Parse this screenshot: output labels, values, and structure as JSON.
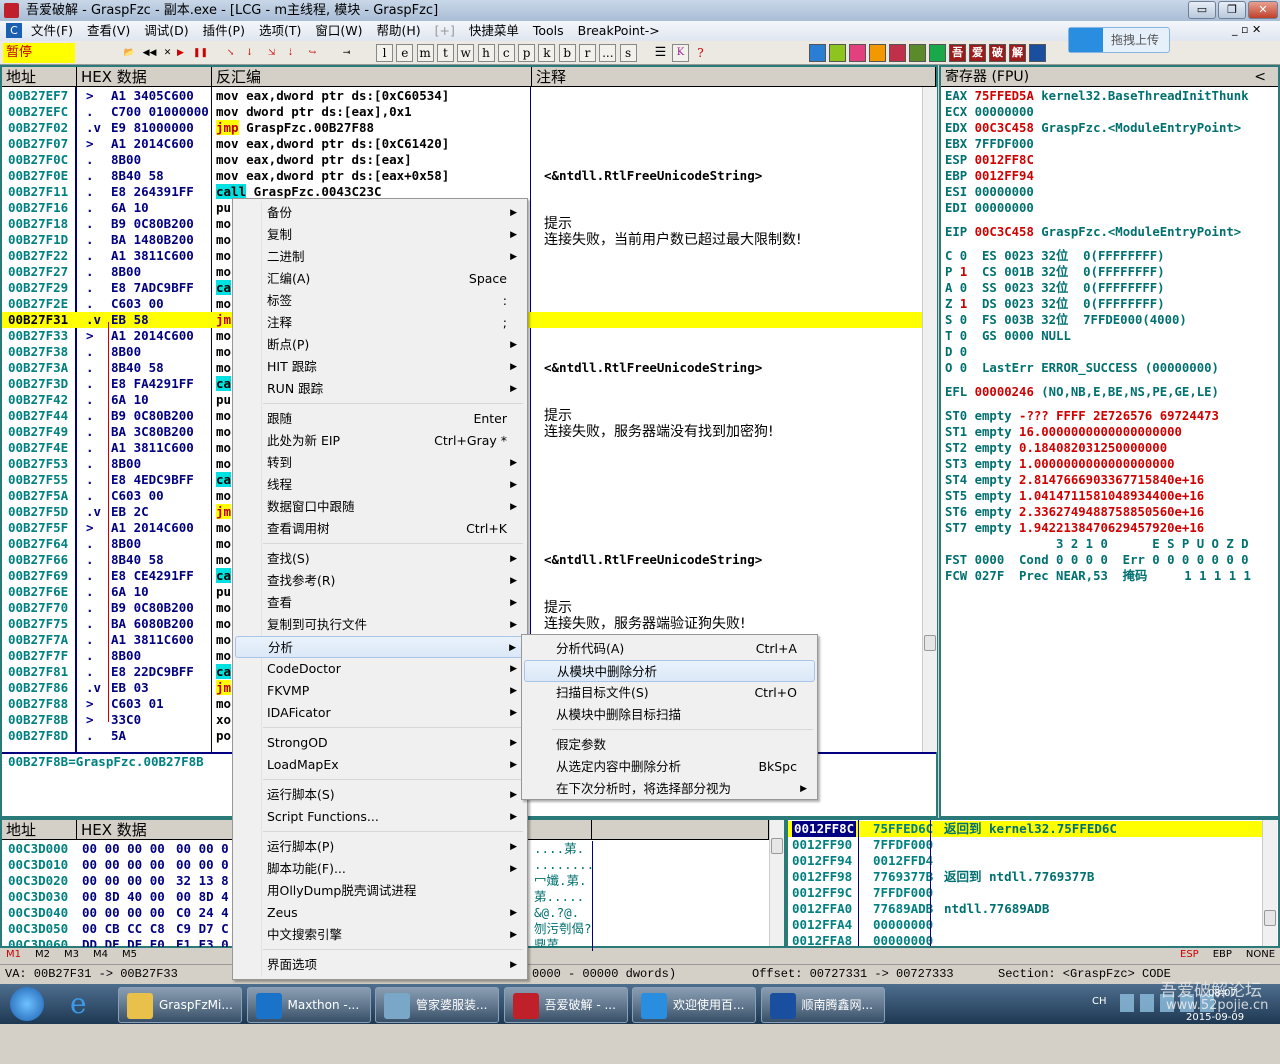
{
  "window": {
    "title": "吾爱破解 - GraspFzc - 副本.exe - [LCG - m主线程, 模块 - GraspFzc]",
    "min": "▭",
    "max": "❐",
    "close": "✕"
  },
  "menu": [
    "文件(F)",
    "查看(V)",
    "调试(D)",
    "插件(P)",
    "选项(T)",
    "窗口(W)",
    "帮助(H)",
    "[+]",
    "快捷菜单",
    "Tools",
    "BreakPoint->"
  ],
  "toolbar": {
    "status": "暂停",
    "letters": [
      "l",
      "e",
      "m",
      "t",
      "w",
      "h",
      "c",
      "p",
      "k",
      "b",
      "r",
      "...",
      "s"
    ],
    "upload_label": "拖拽上传",
    "colors": [
      "#2a7fd4",
      "#8fc31f",
      "#e2407e",
      "#f39800",
      "#c0304a",
      "#5a8a2a",
      "#19a84a",
      "#9c1c1c",
      "#9c1c1c",
      "#9c1c1c",
      "#9c1c1c",
      "#1a4fa0"
    ],
    "brand_chars": [
      "吾",
      "爱",
      "破",
      "解"
    ]
  },
  "disasm": {
    "headers": [
      "地址",
      "HEX 数据",
      "反汇编",
      "注释"
    ],
    "rows": [
      {
        "a": "00B27EF7",
        "m": ">",
        "h": "A1 3405C600",
        "d": "mov eax,dword ptr ds:[0xC60534]"
      },
      {
        "a": "00B27EFC",
        "m": ".",
        "h": "C700 01000000",
        "d": "mov dword ptr ds:[eax],0x1"
      },
      {
        "a": "00B27F02",
        "m": ".v",
        "h": "E9 81000000",
        "d": "jmp",
        "d2": " GraspFzc.00B27F88",
        "k": "jmp"
      },
      {
        "a": "00B27F07",
        "m": ">",
        "h": "A1 2014C600",
        "d": "mov eax,dword ptr ds:[0xC61420]"
      },
      {
        "a": "00B27F0C",
        "m": ".",
        "h": "8B00",
        "d": "mov eax,dword ptr ds:[eax]"
      },
      {
        "a": "00B27F0E",
        "m": ".",
        "h": "8B40 58",
        "d": "mov eax,dword ptr ds:[eax+0x58]",
        "c": "<&ntdll.RtlFreeUnicodeString>"
      },
      {
        "a": "00B27F11",
        "m": ".",
        "h": "E8 264391FF",
        "d": "call",
        "d2": " GraspFzc.0043C23C",
        "k": "call"
      },
      {
        "a": "00B27F16",
        "m": ".",
        "h": "6A 10",
        "d": "pu"
      },
      {
        "a": "00B27F18",
        "m": ".",
        "h": "B9 0C80B200",
        "d": "mo",
        "c": "提示"
      },
      {
        "a": "00B27F1D",
        "m": ".",
        "h": "BA 1480B200",
        "d": "mo",
        "c": "连接失败，当前用户数已超过最大限制数!"
      },
      {
        "a": "00B27F22",
        "m": ".",
        "h": "A1 3811C600",
        "d": "mo"
      },
      {
        "a": "00B27F27",
        "m": ".",
        "h": "8B00",
        "d": "mo"
      },
      {
        "a": "00B27F29",
        "m": ".",
        "h": "E8 7ADC9BFF",
        "d": "ca",
        "k": "call"
      },
      {
        "a": "00B27F2E",
        "m": ".",
        "h": "C603 00",
        "d": "mo"
      },
      {
        "a": "00B27F31",
        "m": ".v",
        "h": "EB 58",
        "d": "jm",
        "k": "jmp",
        "sel": true
      },
      {
        "a": "00B27F33",
        "m": ">",
        "h": "A1 2014C600",
        "d": "mo"
      },
      {
        "a": "00B27F38",
        "m": ".",
        "h": "8B00",
        "d": "mo"
      },
      {
        "a": "00B27F3A",
        "m": ".",
        "h": "8B40 58",
        "d": "mo",
        "c": "<&ntdll.RtlFreeUnicodeString>"
      },
      {
        "a": "00B27F3D",
        "m": ".",
        "h": "E8 FA4291FF",
        "d": "ca",
        "k": "call"
      },
      {
        "a": "00B27F42",
        "m": ".",
        "h": "6A 10",
        "d": "pu"
      },
      {
        "a": "00B27F44",
        "m": ".",
        "h": "B9 0C80B200",
        "d": "mo",
        "c": "提示"
      },
      {
        "a": "00B27F49",
        "m": ".",
        "h": "BA 3C80B200",
        "d": "mo",
        "c": "连接失败，服务器端没有找到加密狗!"
      },
      {
        "a": "00B27F4E",
        "m": ".",
        "h": "A1 3811C600",
        "d": "mo"
      },
      {
        "a": "00B27F53",
        "m": ".",
        "h": "8B00",
        "d": "mo"
      },
      {
        "a": "00B27F55",
        "m": ".",
        "h": "E8 4EDC9BFF",
        "d": "ca",
        "k": "call"
      },
      {
        "a": "00B27F5A",
        "m": ".",
        "h": "C603 00",
        "d": "mo"
      },
      {
        "a": "00B27F5D",
        "m": ".v",
        "h": "EB 2C",
        "d": "jm",
        "k": "jmp"
      },
      {
        "a": "00B27F5F",
        "m": ">",
        "h": "A1 2014C600",
        "d": "mo"
      },
      {
        "a": "00B27F64",
        "m": ".",
        "h": "8B00",
        "d": "mo"
      },
      {
        "a": "00B27F66",
        "m": ".",
        "h": "8B40 58",
        "d": "mo",
        "c": "<&ntdll.RtlFreeUnicodeString>"
      },
      {
        "a": "00B27F69",
        "m": ".",
        "h": "E8 CE4291FF",
        "d": "ca",
        "k": "call"
      },
      {
        "a": "00B27F6E",
        "m": ".",
        "h": "6A 10",
        "d": "pu"
      },
      {
        "a": "00B27F70",
        "m": ".",
        "h": "B9 0C80B200",
        "d": "mo",
        "c": "提示"
      },
      {
        "a": "00B27F75",
        "m": ".",
        "h": "BA 6080B200",
        "d": "mo",
        "c": "连接失败，服务器端验证狗失败!"
      },
      {
        "a": "00B27F7A",
        "m": ".",
        "h": "A1 3811C600",
        "d": "mo"
      },
      {
        "a": "00B27F7F",
        "m": ".",
        "h": "8B00",
        "d": "mo"
      },
      {
        "a": "00B27F81",
        "m": ".",
        "h": "E8 22DC9BFF",
        "d": "ca",
        "k": "call"
      },
      {
        "a": "00B27F86",
        "m": ".v",
        "h": "EB 03",
        "d": "jm",
        "k": "jmp"
      },
      {
        "a": "00B27F88",
        "m": ">",
        "h": "C603 01",
        "d": "mo"
      },
      {
        "a": "00B27F8B",
        "m": ">",
        "h": "33C0",
        "d": "xo"
      },
      {
        "a": "00B27F8D",
        "m": ".",
        "h": "5A",
        "d": "po"
      }
    ],
    "info": "00B27F8B=GraspFzc.00B27F8B"
  },
  "registers": {
    "header": "寄存器 (FPU)",
    "collapse": "<",
    "lines": [
      [
        [
          "EAX ",
          "t"
        ],
        [
          "75FFED5A",
          "r"
        ],
        [
          " kernel32.BaseThreadInitThunk",
          "t"
        ]
      ],
      [
        [
          "ECX 00000000",
          "t"
        ]
      ],
      [
        [
          "EDX ",
          "t"
        ],
        [
          "00C3C458",
          "r"
        ],
        [
          " GraspFzc.<ModuleEntryPoint>",
          "t"
        ]
      ],
      [
        [
          "EBX 7FFDF000",
          "t"
        ]
      ],
      [
        [
          "ESP ",
          "t"
        ],
        [
          "0012FF8C",
          "r"
        ]
      ],
      [
        [
          "EBP ",
          "t"
        ],
        [
          "0012FF94",
          "r"
        ]
      ],
      [
        [
          "ESI 00000000",
          "t"
        ]
      ],
      [
        [
          "EDI 00000000",
          "t"
        ]
      ],
      [],
      [
        [
          "EIP ",
          "t"
        ],
        [
          "00C3C458",
          "r"
        ],
        [
          " GraspFzc.<ModuleEntryPoint>",
          "t"
        ]
      ],
      [],
      [
        [
          "C 0  ES 0023 32位  0(FFFFFFFF)",
          "t"
        ]
      ],
      [
        [
          "P ",
          "t"
        ],
        [
          "1",
          "r"
        ],
        [
          "  CS 001B 32位  0(FFFFFFFF)",
          "t"
        ]
      ],
      [
        [
          "A 0  SS 0023 32位  0(FFFFFFFF)",
          "t"
        ]
      ],
      [
        [
          "Z ",
          "t"
        ],
        [
          "1",
          "r"
        ],
        [
          "  DS 0023 32位  0(FFFFFFFF)",
          "t"
        ]
      ],
      [
        [
          "S 0  FS 003B 32位  7FFDE000(4000)",
          "t"
        ]
      ],
      [
        [
          "T 0  GS 0000 NULL",
          "t"
        ]
      ],
      [
        [
          "D 0",
          "t"
        ]
      ],
      [
        [
          "O 0  LastErr ERROR_SUCCESS (00000000)",
          "t"
        ]
      ],
      [],
      [
        [
          "EFL ",
          "t"
        ],
        [
          "00000246",
          "r"
        ],
        [
          " (NO,NB,E,BE,NS,PE,GE,LE)",
          "t"
        ]
      ],
      [],
      [
        [
          "ST0 empty ",
          "t"
        ],
        [
          "-??? FFFF 2E726576 69724473",
          "r"
        ]
      ],
      [
        [
          "ST1 empty ",
          "t"
        ],
        [
          "16.0000000000000000000",
          "r"
        ]
      ],
      [
        [
          "ST2 empty ",
          "t"
        ],
        [
          "0.184082031250000000",
          "r"
        ]
      ],
      [
        [
          "ST3 empty ",
          "t"
        ],
        [
          "1.0000000000000000000",
          "r"
        ]
      ],
      [
        [
          "ST4 empty ",
          "t"
        ],
        [
          "2.8147666903367715840e+16",
          "r"
        ]
      ],
      [
        [
          "ST5 empty ",
          "t"
        ],
        [
          "1.0414711581048934400e+16",
          "r"
        ]
      ],
      [
        [
          "ST6 empty ",
          "t"
        ],
        [
          "2.3362749488758850560e+16",
          "r"
        ]
      ],
      [
        [
          "ST7 empty ",
          "t"
        ],
        [
          "1.9422138470629457920e+16",
          "r"
        ]
      ],
      [
        [
          "               3 2 1 0      E S P U O Z D",
          "t"
        ]
      ],
      [
        [
          "FST 0000  Cond 0 0 0 0  Err 0 0 0 0 0 0 0",
          "t"
        ]
      ],
      [
        [
          "FCW 027F  Prec NEAR,53  掩码     1 1 1 1 1",
          "t"
        ]
      ]
    ]
  },
  "dump": {
    "headers": [
      "地址",
      "HEX 数据"
    ],
    "rows": [
      {
        "a": "00C3D000",
        "h1": "00 00 00 00",
        "h2": "00 00 0",
        "s": "....苐."
      },
      {
        "a": "00C3D010",
        "h1": "00 00 00 00",
        "h2": "00 00 0",
        "s": "........"
      },
      {
        "a": "00C3D020",
        "h1": "00 00 00 00",
        "h2": "32 13 8",
        "s": "冖孅.苐."
      },
      {
        "a": "00C3D030",
        "h1": "00 8D 40 00",
        "h2": "00 8D 4",
        "s": "苐....."
      },
      {
        "a": "00C3D040",
        "h1": "00 00 00 00",
        "h2": "C0 24 4",
        "s": "&@.?@."
      },
      {
        "a": "00C3D050",
        "h1": "00 CB CC C8",
        "h2": "C9 D7 C",
        "s": "刎污刳偈?"
      },
      {
        "a": "00C3D060",
        "h1": "DD DE DF E0",
        "h2": "E1 E3 0",
        "s": "鼎苐"
      }
    ],
    "mtabs": [
      "M1",
      "M2",
      "M3",
      "M4",
      "M5"
    ]
  },
  "stack": {
    "rows": [
      {
        "a": "0012FF8C",
        "v": "75FFED6C",
        "c": "返回到 kernel32.75FFED6C",
        "sel": true
      },
      {
        "a": "0012FF90",
        "v": "7FFDF000",
        "c": ""
      },
      {
        "a": "0012FF94",
        "v": "0012FFD4",
        "c": ""
      },
      {
        "a": "0012FF98",
        "v": "7769377B",
        "c": "返回到 ntdll.7769377B"
      },
      {
        "a": "0012FF9C",
        "v": "7FFDF000",
        "c": ""
      },
      {
        "a": "0012FFA0",
        "v": "77689ADB",
        "c": "ntdll.77689ADB"
      },
      {
        "a": "0012FFA4",
        "v": "00000000",
        "c": ""
      },
      {
        "a": "0012FFA8",
        "v": "00000000",
        "c": ""
      }
    ],
    "modes": [
      "ESP",
      "EBP",
      "NONE"
    ]
  },
  "status": {
    "va": "VA: 00B27F31 -> 00B27F33",
    "dwords": "0000 - 00000 dwords)",
    "offset": "Offset: 00727331 -> 00727333",
    "section": "Section: <GraspFzc> CODE"
  },
  "context_menu": [
    {
      "l": "备份",
      "sub": true
    },
    {
      "l": "复制",
      "sub": true
    },
    {
      "l": "二进制",
      "sub": true
    },
    {
      "l": "汇编(A)",
      "s": "Space"
    },
    {
      "l": "标签",
      "s": ":"
    },
    {
      "l": "注释",
      "s": ";"
    },
    {
      "l": "断点(P)",
      "sub": true
    },
    {
      "l": "HIT 跟踪",
      "sub": true
    },
    {
      "l": "RUN 跟踪",
      "sub": true
    },
    {
      "sep": true
    },
    {
      "l": "跟随",
      "s": "Enter"
    },
    {
      "l": "此处为新 EIP",
      "s": "Ctrl+Gray *"
    },
    {
      "l": "转到",
      "sub": true
    },
    {
      "l": "线程",
      "sub": true
    },
    {
      "l": "数据窗口中跟随",
      "sub": true
    },
    {
      "l": "查看调用树",
      "s": "Ctrl+K"
    },
    {
      "sep": true
    },
    {
      "l": "查找(S)",
      "sub": true
    },
    {
      "l": "查找参考(R)",
      "sub": true
    },
    {
      "l": "查看",
      "sub": true
    },
    {
      "l": "复制到可执行文件",
      "sub": true
    },
    {
      "l": "分析",
      "sub": true,
      "hl": true
    },
    {
      "l": "CodeDoctor",
      "sub": true
    },
    {
      "l": "FKVMP",
      "sub": true
    },
    {
      "l": "IDAFicator",
      "sub": true
    },
    {
      "sep": true
    },
    {
      "l": "StrongOD",
      "sub": true
    },
    {
      "l": "LoadMapEx",
      "sub": true
    },
    {
      "sep": true
    },
    {
      "l": "运行脚本(S)",
      "sub": true
    },
    {
      "l": "Script Functions...",
      "sub": true
    },
    {
      "sep": true
    },
    {
      "l": "运行脚本(P)",
      "sub": true
    },
    {
      "l": "脚本功能(F)...",
      "sub": true
    },
    {
      "l": "用OllyDump脱壳调试进程"
    },
    {
      "l": "Zeus",
      "sub": true
    },
    {
      "l": "中文搜索引擎",
      "sub": true
    },
    {
      "sep": true
    },
    {
      "l": "界面选项",
      "sub": true
    }
  ],
  "submenu": [
    {
      "l": "分析代码(A)",
      "s": "Ctrl+A"
    },
    {
      "l": "从模块中删除分析",
      "hl": true
    },
    {
      "l": "扫描目标文件(S)",
      "s": "Ctrl+O"
    },
    {
      "l": "从模块中删除目标扫描"
    },
    {
      "sep": true
    },
    {
      "l": "假定参数"
    },
    {
      "l": "从选定内容中删除分析",
      "s": "BkSpc"
    },
    {
      "l": "在下次分析时，将选择部分视为",
      "sub": true
    }
  ],
  "taskbar": {
    "items": [
      {
        "l": "GraspFzMi...",
        "c": "#e8c04a"
      },
      {
        "l": "Maxthon -...",
        "c": "#1a73c8"
      },
      {
        "l": "管家婆服装...",
        "c": "#7aa6c8"
      },
      {
        "l": "吾爱破解 - ...",
        "c": "#c0202a"
      },
      {
        "l": "欢迎使用百...",
        "c": "#2a8ee0"
      },
      {
        "l": "顺南腾鑫网...",
        "c": "#1a4fa0"
      }
    ],
    "lang": "CH",
    "time": "08:07",
    "date": "2015-09-09",
    "watermark_title": "吾爱破解论坛",
    "watermark_url": "www.52pojie.cn"
  }
}
